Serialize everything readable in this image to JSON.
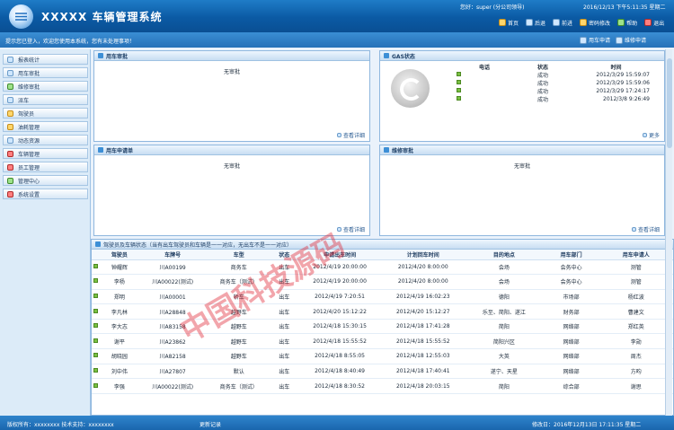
{
  "header": {
    "title": "XXXXX 车辆管理系统",
    "user": "您好：super (分公司领导)",
    "datetime": "2016/12/13 下午5:11:35 星期二",
    "menu": [
      {
        "label": "首页",
        "icon": "home-icon"
      },
      {
        "label": "后退",
        "icon": "back-icon"
      },
      {
        "label": "前进",
        "icon": "forward-icon"
      },
      {
        "label": "密码修改",
        "icon": "key-icon"
      },
      {
        "label": "帮助",
        "icon": "help-icon"
      },
      {
        "label": "退出",
        "icon": "exit-icon"
      }
    ]
  },
  "subbar": {
    "notice": "提示您已登入，欢迎您使用本系统，您有未处理事项！",
    "right": [
      {
        "label": "用车申请",
        "icon": "car-icon"
      },
      {
        "label": "维修申请",
        "icon": "wrench-icon"
      }
    ]
  },
  "sidebar": {
    "items": [
      {
        "label": "报表统计",
        "icon": "report-icon"
      },
      {
        "label": "用车审批",
        "icon": "approve-icon"
      },
      {
        "label": "维修审批",
        "icon": "repair-icon"
      },
      {
        "label": "派车",
        "icon": "dispatch-icon"
      },
      {
        "label": "驾驶员",
        "icon": "driver-icon"
      },
      {
        "label": "油耗管理",
        "icon": "fuel-icon"
      },
      {
        "label": "动态资源",
        "icon": "resource-icon"
      },
      {
        "label": "车辆管理",
        "icon": "car-icon"
      },
      {
        "label": "员工管理",
        "icon": "staff-icon"
      },
      {
        "label": "管理中心",
        "icon": "globe-icon"
      },
      {
        "label": "系统设置",
        "icon": "settings-icon"
      }
    ]
  },
  "panels": {
    "car_approval": {
      "title": "用车审批",
      "empty": "无审批",
      "more": "查看详细"
    },
    "gas": {
      "title": "GAS状态",
      "headers": [
        "电话",
        "状态",
        "时间"
      ],
      "rows": [
        {
          "phone": "",
          "status": "成功",
          "time": "2012/3/29 15:59:07"
        },
        {
          "phone": "",
          "status": "成功",
          "time": "2012/3/29 15:59:06"
        },
        {
          "phone": "",
          "status": "成功",
          "time": "2012/3/29 17:24:17"
        },
        {
          "phone": "",
          "status": "成功",
          "time": "2012/3/8 9:26:49"
        }
      ],
      "more": "更多"
    },
    "car_request": {
      "title": "用车申请单",
      "empty": "无审批",
      "more": "查看详细"
    },
    "repair_approval": {
      "title": "维修审批",
      "empty": "无审批",
      "more": "查看详细"
    }
  },
  "bottom_table": {
    "title": "驾驶员及车辆状态（当有出车驾驶员和车辆是一一对应，无出车不是一一对应）",
    "headers": [
      "驾驶员",
      "车牌号",
      "车型",
      "状态",
      "申请出车时间",
      "计划回车时间",
      "目的地点",
      "用车部门",
      "用车申请人"
    ],
    "rows": [
      [
        "钟耀辉",
        "川A00199",
        "商务车",
        "出车",
        "2012/4/19 20:00:00",
        "2012/4/20 8:00:00",
        "会场",
        "会务中心",
        "测管"
      ],
      [
        "李杨",
        "川A00022(测试)",
        "商务车（测试）",
        "出车",
        "2012/4/19 20:00:00",
        "2012/4/20 8:00:00",
        "会场",
        "会务中心",
        "测管"
      ],
      [
        "郑明",
        "川A00001",
        "轿车",
        "出车",
        "2012/4/19 7:20:51",
        "2012/4/19 16:02:23",
        "德阳",
        "市场部",
        "杨红波"
      ],
      [
        "李凡林",
        "川A28848",
        "越野车",
        "出车",
        "2012/4/20 15:12:22",
        "2012/4/20 15:12:27",
        "乐至、简阳、遂江",
        "财务部",
        "曹建文"
      ],
      [
        "李大志",
        "川A83158",
        "越野车",
        "出车",
        "2012/4/18 15:30:15",
        "2012/4/18 17:41:28",
        "简阳",
        "网络部",
        "郑红英"
      ],
      [
        "谢平",
        "川A23862",
        "越野车",
        "出车",
        "2012/4/18 15:55:52",
        "2012/4/18 15:55:52",
        "简阳兴区",
        "网络部",
        "李勋"
      ],
      [
        "胡晓园",
        "川A82158",
        "越野车",
        "出车",
        "2012/4/18 8:55:05",
        "2012/4/18 12:55:03",
        "大英",
        "网络部",
        "周杰"
      ],
      [
        "刘中伟",
        "川A27807",
        "默认",
        "出车",
        "2012/4/18 8:40:49",
        "2012/4/18 17:40:41",
        "遂宁、天星",
        "网络部",
        "方昀"
      ],
      [
        "李强",
        "川A00022(测试)",
        "商务车（测试）",
        "出车",
        "2012/4/18 8:30:52",
        "2012/4/18 20:03:15",
        "简阳",
        "综合部",
        "谢思"
      ]
    ]
  },
  "status": {
    "left": "版权所有：xxxxxxxx 技术支持：xxxxxxxx",
    "middle": "更新记录",
    "right": "修改日：2016年12月13日 17:11:35 星期二"
  },
  "watermark": "中国科技源码",
  "colors": {
    "header": "#0b5aa4",
    "accent": "#2671b8",
    "panel_border": "#8fb7de",
    "status_ok": "#7ac043",
    "watermark": "#e12837"
  }
}
